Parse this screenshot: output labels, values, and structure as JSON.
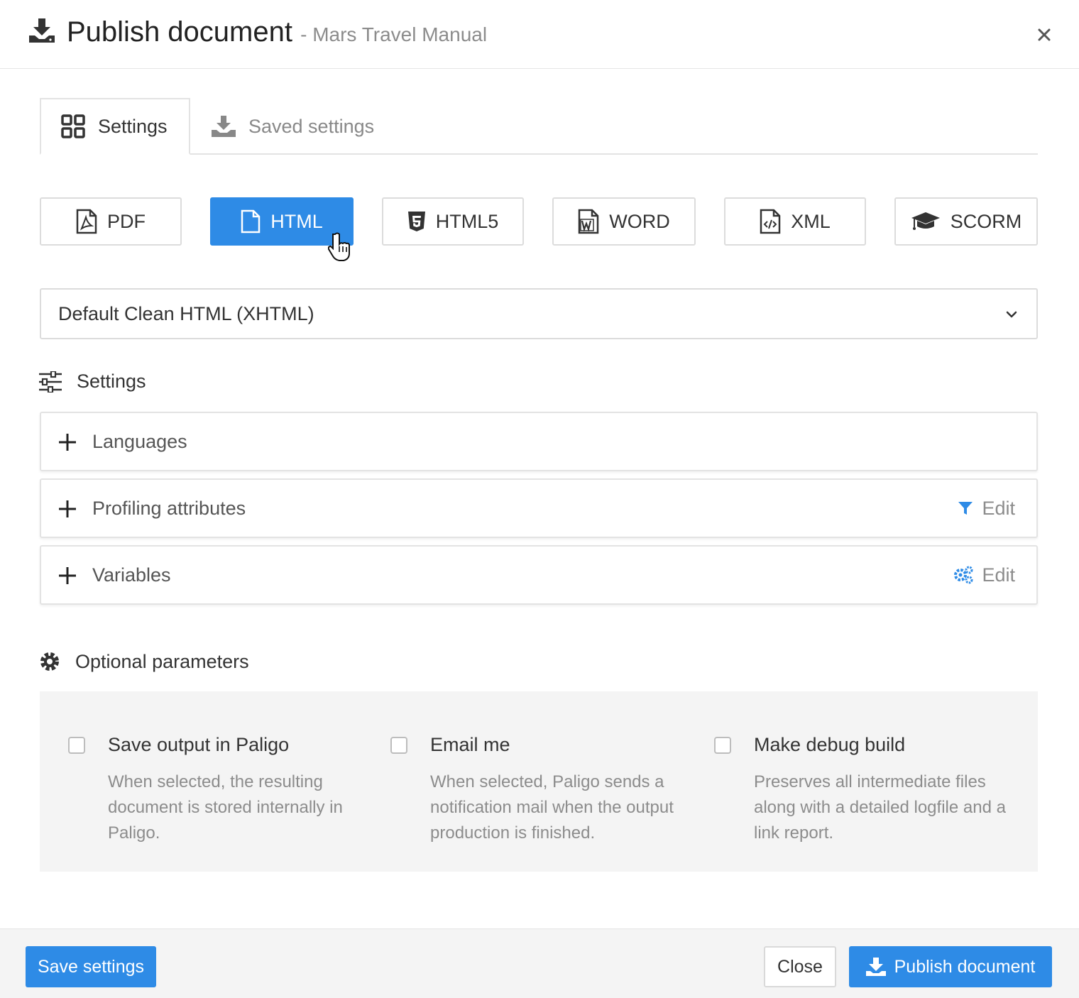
{
  "header": {
    "title": "Publish document",
    "subtitle": "- Mars Travel Manual"
  },
  "tabs": [
    {
      "label": "Settings",
      "active": true
    },
    {
      "label": "Saved settings",
      "active": false
    }
  ],
  "formats": [
    {
      "label": "PDF",
      "icon": "pdf-file-icon",
      "active": false
    },
    {
      "label": "HTML",
      "icon": "file-icon",
      "active": true
    },
    {
      "label": "HTML5",
      "icon": "html5-icon",
      "active": false
    },
    {
      "label": "WORD",
      "icon": "word-file-icon",
      "active": false
    },
    {
      "label": "XML",
      "icon": "code-file-icon",
      "active": false
    },
    {
      "label": "SCORM",
      "icon": "graduation-cap-icon",
      "active": false
    }
  ],
  "layout_select": {
    "value": "Default Clean HTML (XHTML)"
  },
  "settings_section": {
    "title": "Settings"
  },
  "accordions": [
    {
      "label": "Languages"
    },
    {
      "label": "Profiling attributes",
      "edit_label": "Edit"
    },
    {
      "label": "Variables",
      "edit_label": "Edit"
    }
  ],
  "optional": {
    "title": "Optional parameters",
    "options": [
      {
        "title": "Save output in Paligo",
        "description": "When selected, the resulting document is stored internally in Paligo.",
        "checked": false
      },
      {
        "title": "Email me",
        "description": "When selected, Paligo sends a notification mail when the output production is finished.",
        "checked": false
      },
      {
        "title": "Make debug build",
        "description": "Preserves all intermediate files along with a detailed logfile and a link report.",
        "checked": false
      }
    ]
  },
  "footer": {
    "save_label": "Save settings",
    "close_label": "Close",
    "publish_label": "Publish document"
  },
  "colors": {
    "accent": "#2e8be6"
  }
}
